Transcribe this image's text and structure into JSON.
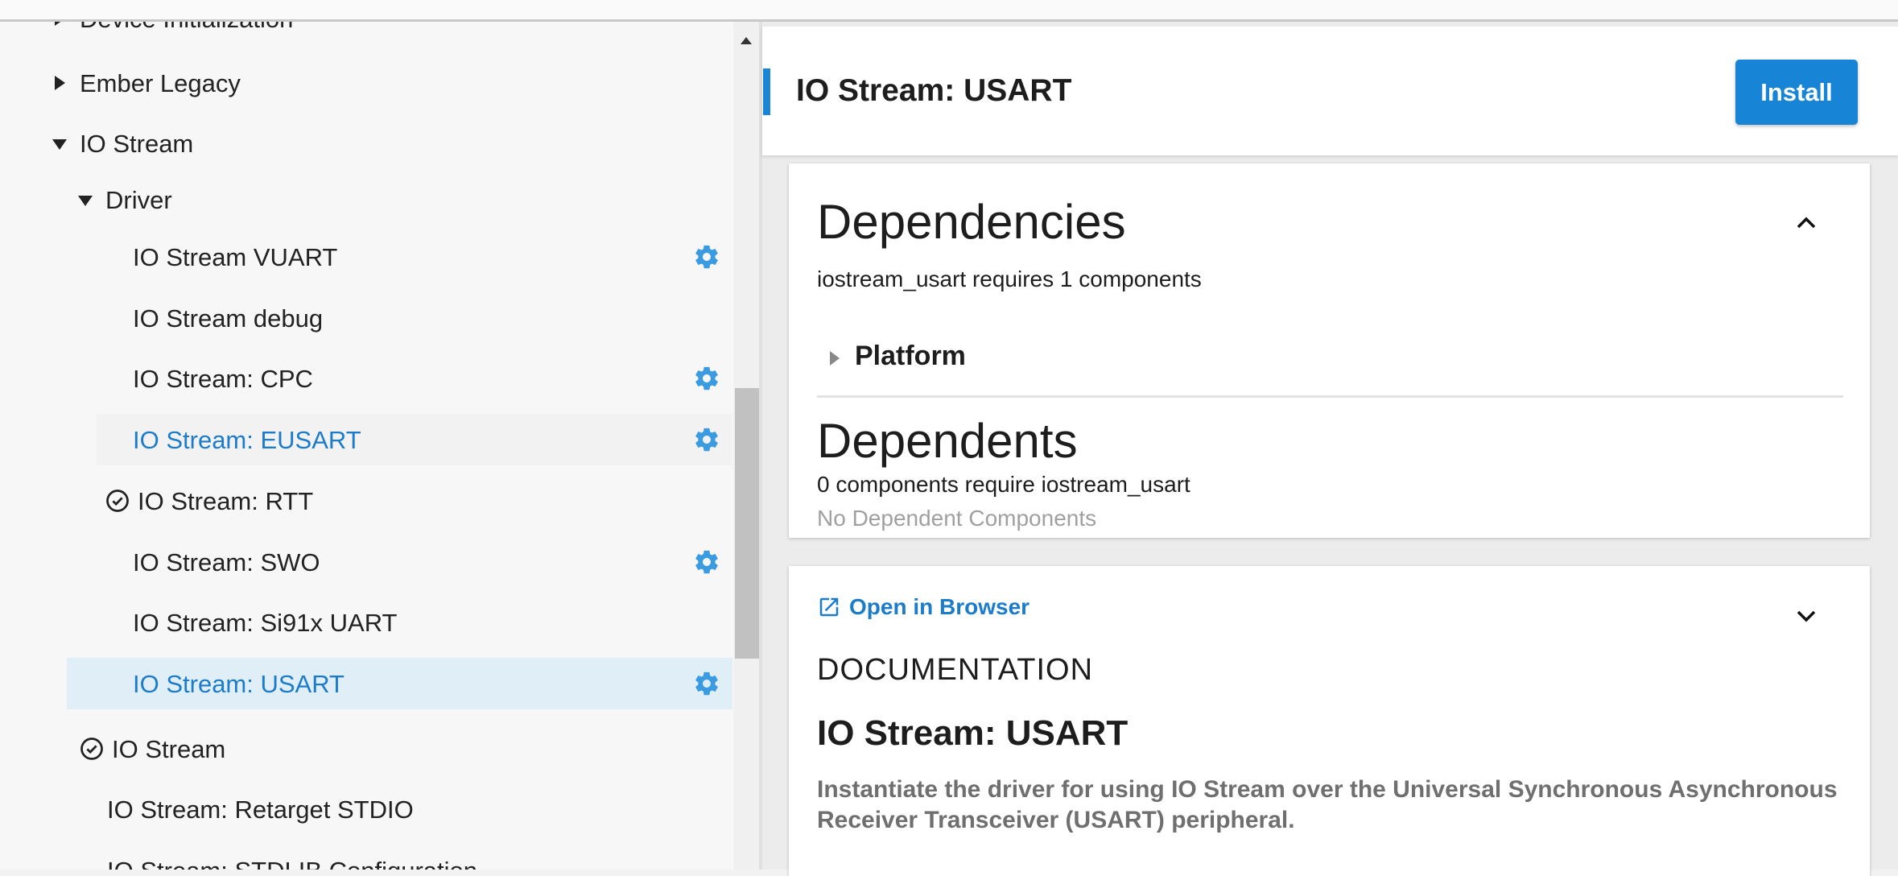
{
  "tree": {
    "partial_top": "Device Initialization",
    "items": [
      {
        "label": "Ember Legacy"
      },
      {
        "label": "IO Stream"
      },
      {
        "label": "Driver"
      },
      {
        "label": "IO Stream VUART"
      },
      {
        "label": "IO Stream debug"
      },
      {
        "label": "IO Stream: CPC"
      },
      {
        "label": "IO Stream: EUSART"
      },
      {
        "label": "IO Stream: RTT"
      },
      {
        "label": "IO Stream: SWO"
      },
      {
        "label": "IO Stream: Si91x UART"
      },
      {
        "label": "IO Stream: USART"
      },
      {
        "label": "IO Stream"
      },
      {
        "label": "IO Stream: Retarget STDIO"
      },
      {
        "label": "IO Stream: STDLIB Configuration"
      }
    ]
  },
  "header": {
    "title": "IO Stream: USART",
    "install_label": "Install"
  },
  "dependencies": {
    "title": "Dependencies",
    "summary": "iostream_usart requires 1 components",
    "group": "Platform"
  },
  "dependents": {
    "title": "Dependents",
    "summary": "0 components require iostream_usart",
    "empty": "No Dependent Components"
  },
  "documentation": {
    "open_link": "Open in Browser",
    "label": "DOCUMENTATION",
    "title": "IO Stream: USART",
    "description": "Instantiate the driver for using IO Stream over the Universal Synchronous Asynchronous Receiver Transceiver (USART) peripheral."
  },
  "colors": {
    "accent": "#1784d6",
    "link": "#1c7cc9",
    "selected_bg": "#dfeef7",
    "gear": "#3b9be0"
  }
}
